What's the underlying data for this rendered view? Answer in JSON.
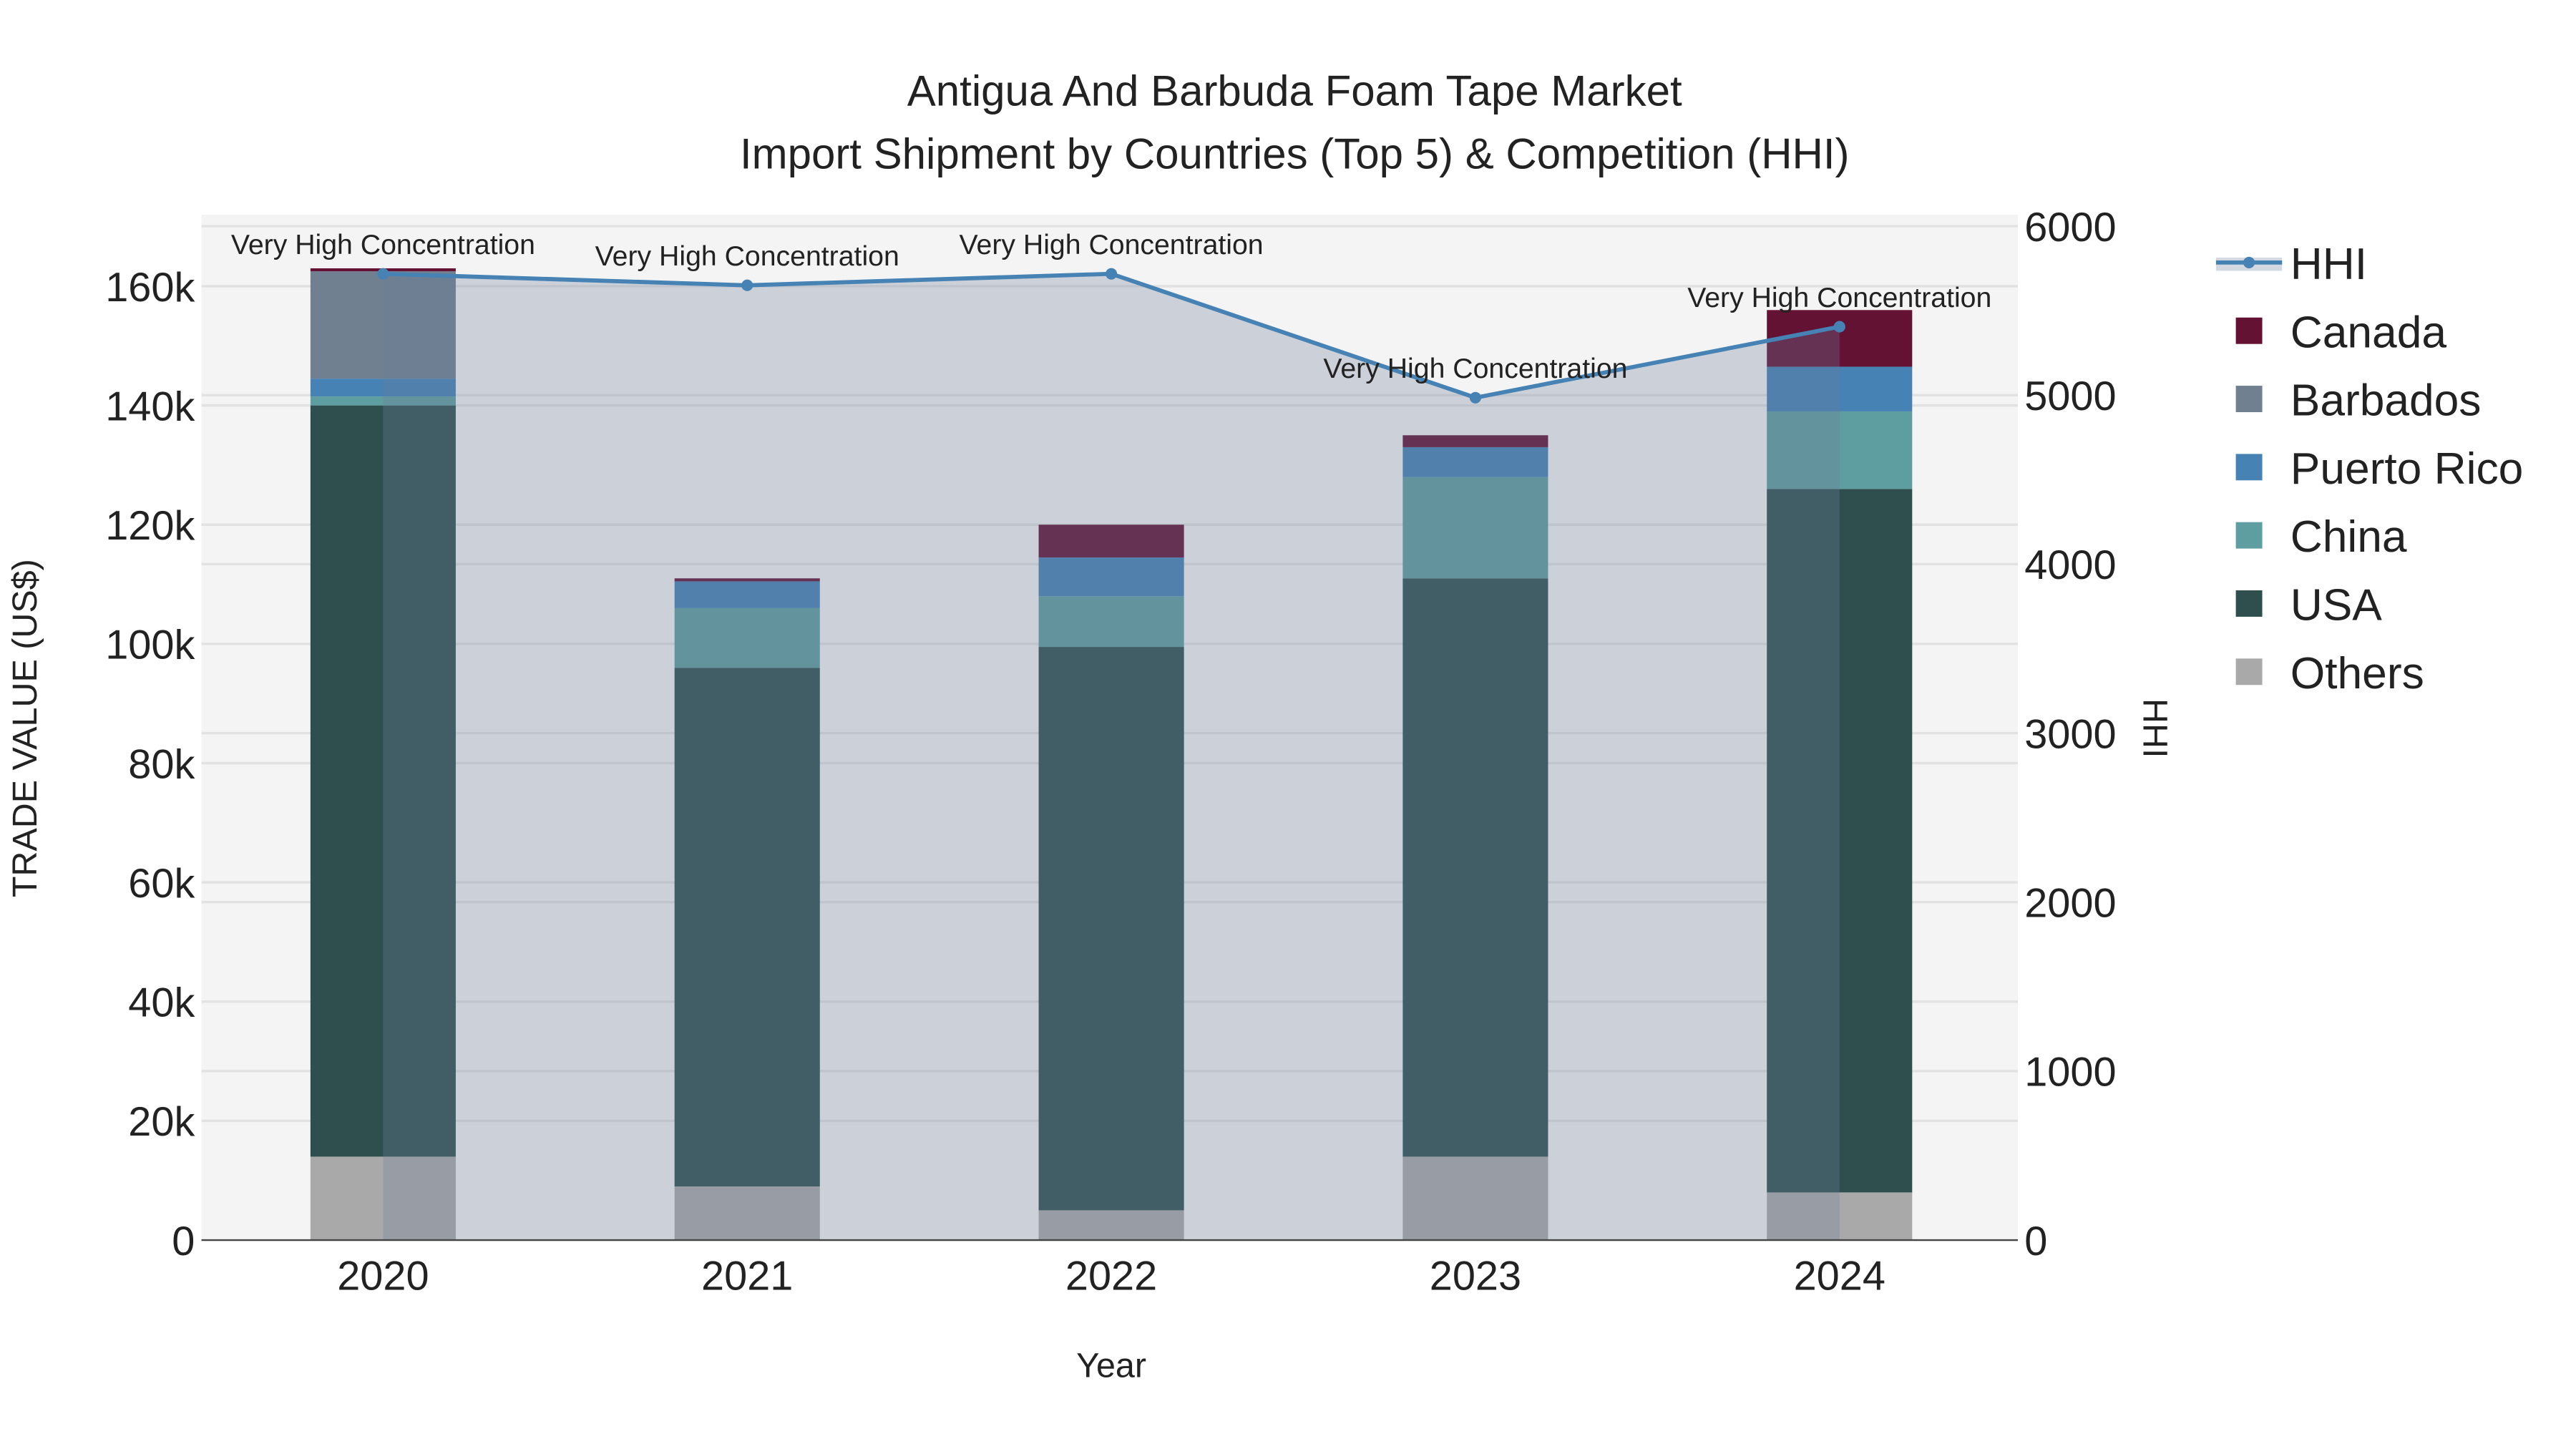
{
  "chart_data": {
    "type": "bar",
    "title_line1": "Antigua And Barbuda Foam Tape Market",
    "title_line2": "Import Shipment by Countries (Top 5) & Competition (HHI)",
    "xlabel": "Year",
    "ylabel": "TRADE VALUE (US$)",
    "y2label": "HHI",
    "categories": [
      "2020",
      "2021",
      "2022",
      "2023",
      "2024"
    ],
    "ylim": [
      0,
      172000
    ],
    "y_ticks": [
      0,
      20000,
      40000,
      60000,
      80000,
      100000,
      120000,
      140000,
      160000
    ],
    "y_tick_labels": [
      "0",
      "20k",
      "40k",
      "60k",
      "80k",
      "100k",
      "120k",
      "140k",
      "160k"
    ],
    "y2lim": [
      0,
      6068
    ],
    "y2_ticks": [
      0,
      1000,
      2000,
      3000,
      4000,
      5000,
      6000
    ],
    "y2_tick_labels": [
      "0",
      "1000",
      "2000",
      "3000",
      "4000",
      "5000",
      "6000"
    ],
    "series": [
      {
        "name": "Others",
        "color": "#A9A9A9",
        "values": [
          14000,
          9000,
          5000,
          14000,
          8000
        ]
      },
      {
        "name": "USA",
        "color": "#2F4F4F",
        "values": [
          126000,
          87000,
          94500,
          97000,
          118000
        ]
      },
      {
        "name": "China",
        "color": "#5F9EA0",
        "values": [
          1500,
          10000,
          8500,
          17000,
          13000
        ]
      },
      {
        "name": "Puerto Rico",
        "color": "#4682B4",
        "values": [
          3000,
          4500,
          6500,
          5000,
          7500
        ]
      },
      {
        "name": "Barbados",
        "color": "#708090",
        "values": [
          18000,
          0,
          0,
          0,
          0
        ]
      },
      {
        "name": "Canada",
        "color": "#631234",
        "values": [
          500,
          500,
          5500,
          2000,
          9500
        ]
      }
    ],
    "hhi": {
      "name": "HHI",
      "color": "#4682B4",
      "values": [
        5718,
        5650,
        5718,
        4985,
        5405
      ]
    },
    "annotations": [
      "Very High Concentration",
      "Very High Concentration",
      "Very High Concentration",
      "Very High Concentration",
      "Very High Concentration"
    ],
    "legend": [
      "HHI",
      "Canada",
      "Barbados",
      "Puerto Rico",
      "China",
      "USA",
      "Others"
    ],
    "legend_placement": "right",
    "grid": true
  }
}
